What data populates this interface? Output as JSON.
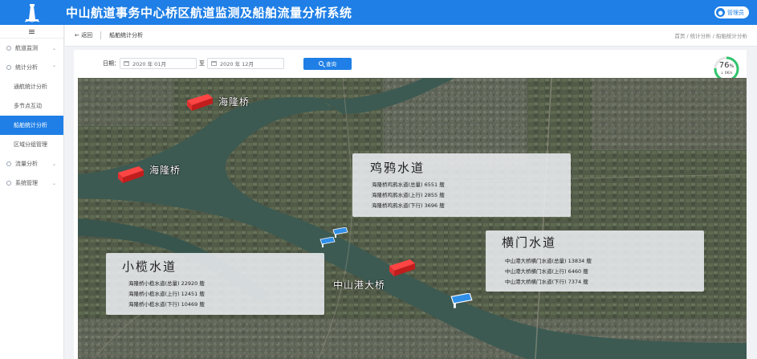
{
  "header": {
    "title": "中山航道事务中心桥区航道监测及船舶流量分析系统",
    "user": "管理员"
  },
  "sidebar": {
    "items": [
      {
        "label": "航道监测",
        "arrow": "⌄"
      },
      {
        "label": "统计分析",
        "arrow": "⌃"
      },
      {
        "label": "流量分析",
        "arrow": "⌄"
      },
      {
        "label": "系统管理",
        "arrow": "⌄"
      }
    ],
    "subitems": [
      "通航统计分析",
      "多节点互动",
      "船舶统计分析",
      "区域分组管理"
    ]
  },
  "crumbbar": {
    "back": "← 返回",
    "tab": "船舶统计分析",
    "crumbs": "首页 / 统计分析 / 船舶统计分析"
  },
  "filter": {
    "label": "日期：",
    "start": "2020 年 01月",
    "to": "至",
    "end": "2020 年 12月",
    "query": "查询"
  },
  "gauge": {
    "value": "76",
    "unit": "%",
    "sub": "↓ 0K/s",
    "fraction": 0.76
  },
  "colors": {
    "brand": "#1f7fe6",
    "bridge": "#e52b2b",
    "camera": "#2f8fe8"
  },
  "map": {
    "bridges": [
      "海隆桥",
      "海隆桥",
      "中山港大桥"
    ],
    "areas": [
      {
        "title": "鸡鸦水道",
        "rows": [
          "海隆桥鸡鸦水道(总量)  6551 艘",
          "海隆桥鸡鸦水道(上行)  2855 艘",
          "海隆桥鸡鸦水道(下行)  3696 艘"
        ]
      },
      {
        "title": "横门水道",
        "rows": [
          "中山港大桥横门水道(总量)  13834 艘",
          "中山港大桥横门水道(上行)  6460 艘",
          "中山港大桥横门水道(下行)  7374 艘"
        ]
      },
      {
        "title": "小榄水道",
        "rows": [
          "海隆桥小榄水道(总量)  22920 艘",
          "海隆桥小榄水道(上行)  12451 艘",
          "海隆桥小榄水道(下行)  10469 艘"
        ]
      }
    ]
  }
}
